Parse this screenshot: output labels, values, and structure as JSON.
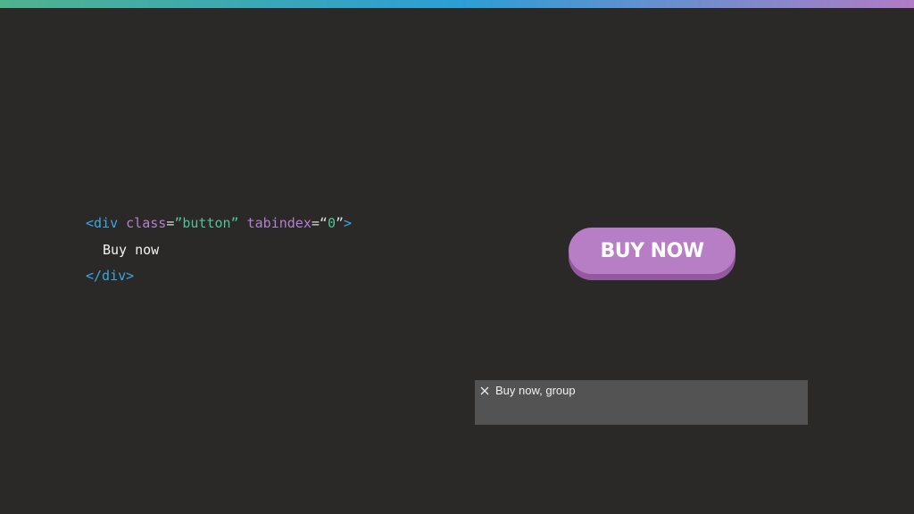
{
  "code": {
    "line1": {
      "open_bracket": "<",
      "tag": "div",
      "attr_class": "class",
      "eq1": "=",
      "class_value": "”button”",
      "attr_tabindex": "tabindex",
      "eq2": "=",
      "tabindex_open_quote": "“",
      "tabindex_value": "0",
      "tabindex_close_quote": "”",
      "close_bracket": ">"
    },
    "line2": {
      "text": "Buy now"
    },
    "line3": {
      "text": "</div>"
    }
  },
  "button": {
    "label": "BUY NOW",
    "color": "#b77ec5",
    "shadow_color": "#93589e"
  },
  "accessibility_panel": {
    "icon": "close-icon",
    "text": "Buy now, group"
  },
  "colors": {
    "background": "#2b2927",
    "gradient": [
      "#4fb38e",
      "#2a9fd6",
      "#b07cc6"
    ]
  }
}
